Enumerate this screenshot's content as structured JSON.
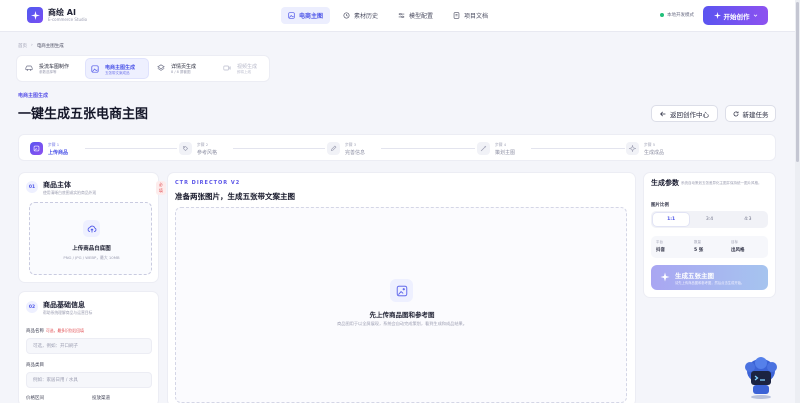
{
  "app": {
    "name": "商绘 AI",
    "subtitle": "E-commerce Studio"
  },
  "nav": {
    "items": [
      {
        "label": "电商主图",
        "icon": "image-icon",
        "active": true
      },
      {
        "label": "素材历史",
        "icon": "history-icon",
        "active": false
      },
      {
        "label": "模型配置",
        "icon": "sliders-icon",
        "active": false
      },
      {
        "label": "项目文档",
        "icon": "book-icon",
        "active": false
      }
    ]
  },
  "header": {
    "mode_label": "本地开发模式",
    "start_button": "开始创作"
  },
  "breadcrumb": {
    "home": "首页",
    "current": "电商主图生成"
  },
  "tool_tabs": [
    {
      "title": "投流车图制作",
      "sub": "参数选择等",
      "state": "normal",
      "icon": "car-icon"
    },
    {
      "title": "电商主图生成",
      "sub": "五张带文案成品",
      "state": "active",
      "icon": "image-icon"
    },
    {
      "title": "详情页生成",
      "sub": "8 / 8 屏套图",
      "state": "normal",
      "icon": "layers-icon"
    },
    {
      "title": "视频生成",
      "sub": "即将上线",
      "state": "dim",
      "icon": "video-icon"
    }
  ],
  "page": {
    "eyebrow": "电商主图生成",
    "title": "一键生成五张电商主图",
    "back_button": "返回创作中心",
    "new_task_button": "新建任务"
  },
  "stepper": [
    {
      "num": "步骤 1",
      "label": "上传商品",
      "active": true,
      "icon": "upload-icon"
    },
    {
      "num": "步骤 2",
      "label": "参考风格",
      "active": false,
      "icon": "palette-icon"
    },
    {
      "num": "步骤 3",
      "label": "完善信息",
      "active": false,
      "icon": "pencil-icon"
    },
    {
      "num": "步骤 4",
      "label": "策划主图",
      "active": false,
      "icon": "wand-icon"
    },
    {
      "num": "步骤 5",
      "label": "生成成品",
      "active": false,
      "icon": "sparkle-icon"
    }
  ],
  "product_card": {
    "badge": "01",
    "title": "商品主体",
    "subtitle": "使用清晰白底图或实拍商品外观",
    "required": "必填",
    "upload_title": "上传商品白底图",
    "upload_hint": "PNG / JPG / WEBP，最大 10MB"
  },
  "info_card": {
    "badge": "02",
    "title": "商品基础信息",
    "subtitle": "帮助系统理解商品与运营目标",
    "fields": [
      {
        "label": "商品名称",
        "hint": "可选，最多识别后回填",
        "placeholder": "可选，例如：开口刷子"
      },
      {
        "label": "商品类目",
        "hint": "",
        "placeholder": "例如：家居日用 / 水具"
      }
    ],
    "price_label": "价格区间",
    "channel_label": "投放渠道"
  },
  "director": {
    "eyebrow": "CTR DIRECTOR V2",
    "title": "准备两张图片，生成五张带文案主图",
    "empty_title": "先上传商品图和参考图",
    "empty_sub": "商品图用于以全屏展现，系统会自动完成策划，看到生成和成品结果。"
  },
  "params": {
    "title": "生成参数",
    "desc": "系统自动策划五张差异化主图并保持统一图片风格。",
    "ratio_label": "图片比例",
    "ratios": [
      {
        "label": "1:1",
        "active": true
      },
      {
        "label": "3:4",
        "active": false
      },
      {
        "label": "4:3",
        "active": false
      }
    ],
    "meta": [
      {
        "k": "平台",
        "v": "抖音"
      },
      {
        "k": "数量",
        "v": "5 张"
      },
      {
        "k": "目标",
        "v": "出风格"
      }
    ],
    "generate_label": "生成五张主图",
    "generate_sub": "请先上传商品图和参考图，然后点击生成开始。"
  },
  "colors": {
    "accent": "#4d55e8",
    "gradient_start": "#5b54f0",
    "gradient_end": "#8d52f0",
    "success": "#22c07a",
    "danger": "#e0474c"
  }
}
